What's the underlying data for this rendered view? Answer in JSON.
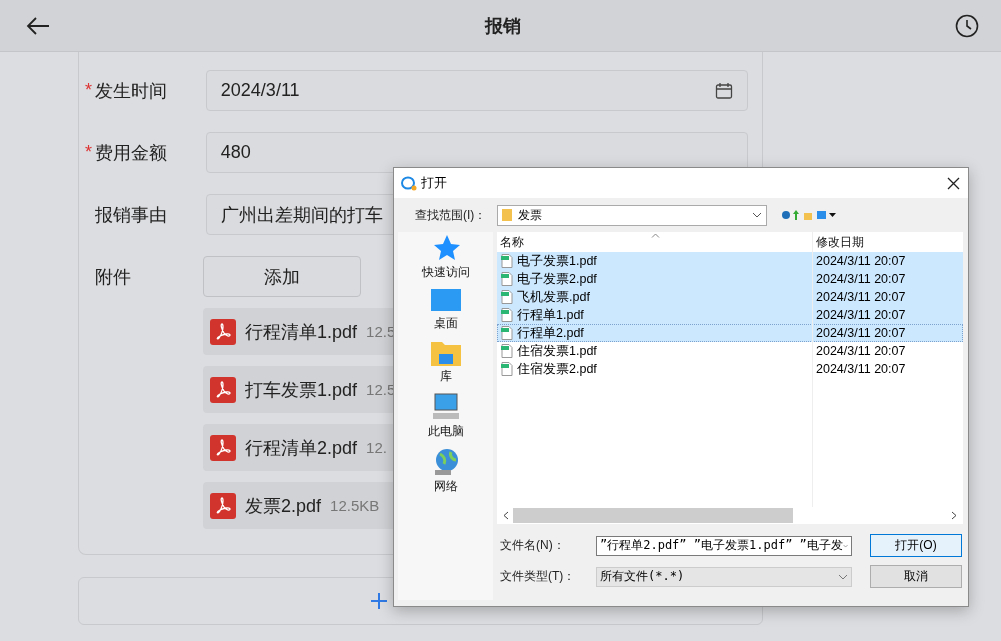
{
  "header": {
    "title": "报销"
  },
  "form": {
    "required_mark": "*",
    "fields": [
      {
        "label": "发生时间",
        "required": true,
        "value": "2024/3/11",
        "kind": "date"
      },
      {
        "label": "费用金额",
        "required": true,
        "value": "480",
        "kind": "text"
      },
      {
        "label": "报销事由",
        "required": false,
        "value": "广州出差期间的打车",
        "kind": "text"
      }
    ],
    "attachments": {
      "label": "附件",
      "button": "添加",
      "files": [
        {
          "name": "行程清单1.pdf",
          "size": "12.5"
        },
        {
          "name": "打车发票1.pdf",
          "size": "12.5"
        },
        {
          "name": "行程清单2.pdf",
          "size": "12."
        },
        {
          "name": "发票2.pdf",
          "size": "12.5KB"
        }
      ]
    }
  },
  "dialog": {
    "title": "打开",
    "look_in_label": "查找范围(I)：",
    "folder": "发票",
    "nav": [
      {
        "label": "快速访问"
      },
      {
        "label": "桌面"
      },
      {
        "label": "库"
      },
      {
        "label": "此电脑"
      },
      {
        "label": "网络"
      }
    ],
    "columns": [
      "名称",
      "修改日期"
    ],
    "files": [
      {
        "name": "电子发票1.pdf",
        "date": "2024/3/11 20:07",
        "selected": true,
        "focused": false
      },
      {
        "name": "电子发票2.pdf",
        "date": "2024/3/11 20:07",
        "selected": true,
        "focused": false
      },
      {
        "name": "飞机发票.pdf",
        "date": "2024/3/11 20:07",
        "selected": true,
        "focused": false
      },
      {
        "name": "行程单1.pdf",
        "date": "2024/3/11 20:07",
        "selected": true,
        "focused": false
      },
      {
        "name": "行程单2.pdf",
        "date": "2024/3/11 20:07",
        "selected": true,
        "focused": true
      },
      {
        "name": "住宿发票1.pdf",
        "date": "2024/3/11 20:07",
        "selected": false,
        "focused": false
      },
      {
        "name": "住宿发票2.pdf",
        "date": "2024/3/11 20:07",
        "selected": false,
        "focused": false
      }
    ],
    "filename_label": "文件名(N)：",
    "filename_value": "”行程单2.pdf” ”电子发票1.pdf” ”电子发",
    "filetype_label": "文件类型(T)：",
    "filetype_value": "所有文件(*.*)",
    "buttons": [
      {
        "label": "打开(O)",
        "default": true
      },
      {
        "label": "取消",
        "default": false
      }
    ]
  }
}
